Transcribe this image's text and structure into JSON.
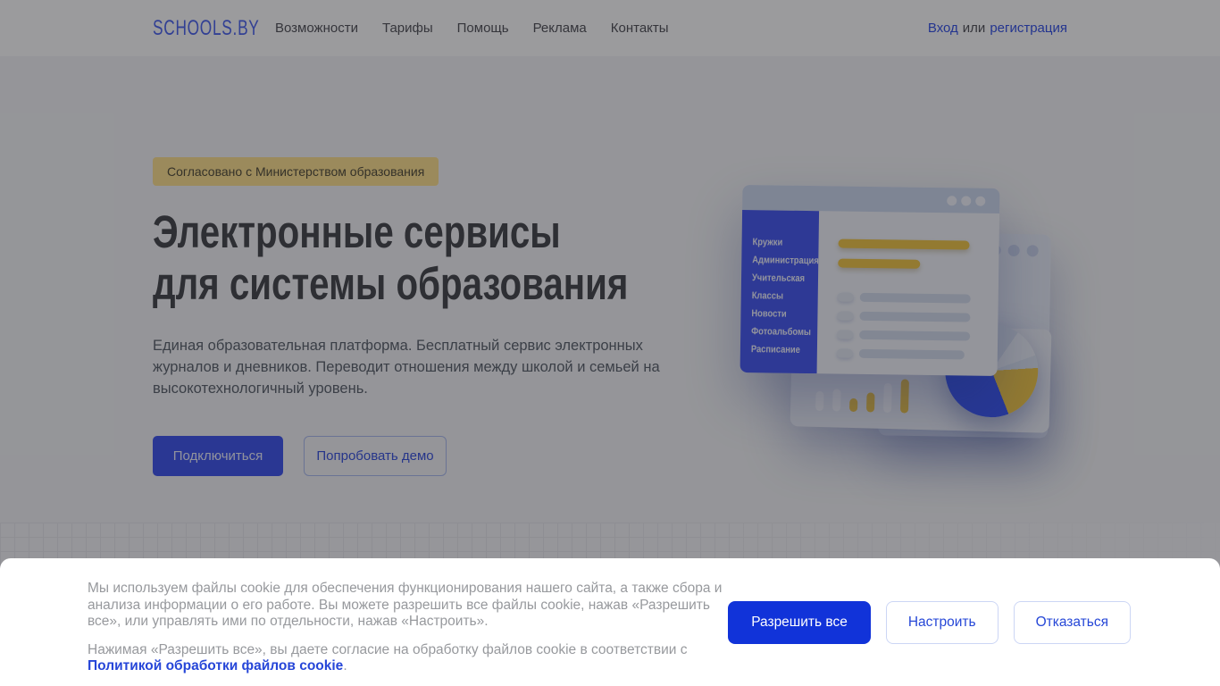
{
  "brand": {
    "logo": "SCHOOLS.BY",
    "accent_blue": "#2742d6"
  },
  "nav": {
    "items": [
      "Возможности",
      "Тарифы",
      "Помощь",
      "Реклама",
      "Контакты"
    ],
    "auth": {
      "login": "Вход",
      "separator": "или",
      "register": "регистрация"
    }
  },
  "hero": {
    "badge": "Согласовано с Министерством образования",
    "badge_bg": "#ffe393",
    "title_line1": "Электронные сервисы",
    "title_line2": "для системы образования",
    "subtitle": "Единая образовательная платформа. Бесплатный сервис электронных журналов и дневников. Переводит отношения между школой и семьей на высокотехнологичный уровень.",
    "cta_primary": "Подключиться",
    "cta_secondary": "Попробовать демо",
    "cta_primary_bg": "#4459ef"
  },
  "illustration": {
    "menu_items": [
      "Кружки",
      "Администрация",
      "Учительская",
      "Классы",
      "Новости",
      "Фотоальбомы",
      "Расписание"
    ],
    "colors": {
      "sidebar_blue": "#4a5cf2",
      "accent_yellow": "#f2c94c",
      "pie_blue": "#3f5bf5"
    }
  },
  "cookie_banner": {
    "paragraph1": "Мы используем файлы cookie для обеспечения функционирования нашего сайта, а также сбора и анализа информации о его работе. Вы можете разрешить все файлы cookie, нажав «Разрешить все», или управлять ими по отдельности, нажав «Настроить».",
    "paragraph2_prefix": "Нажимая «Разрешить все», вы даете согласие на обработку файлов cookie в соответствии с ",
    "policy_link": "Политикой обработки файлов cookie",
    "paragraph2_suffix": ".",
    "buttons": {
      "allow_all": "Разрешить все",
      "configure": "Настроить",
      "decline": "Отказаться"
    },
    "allow_all_bg": "#1133d9"
  }
}
